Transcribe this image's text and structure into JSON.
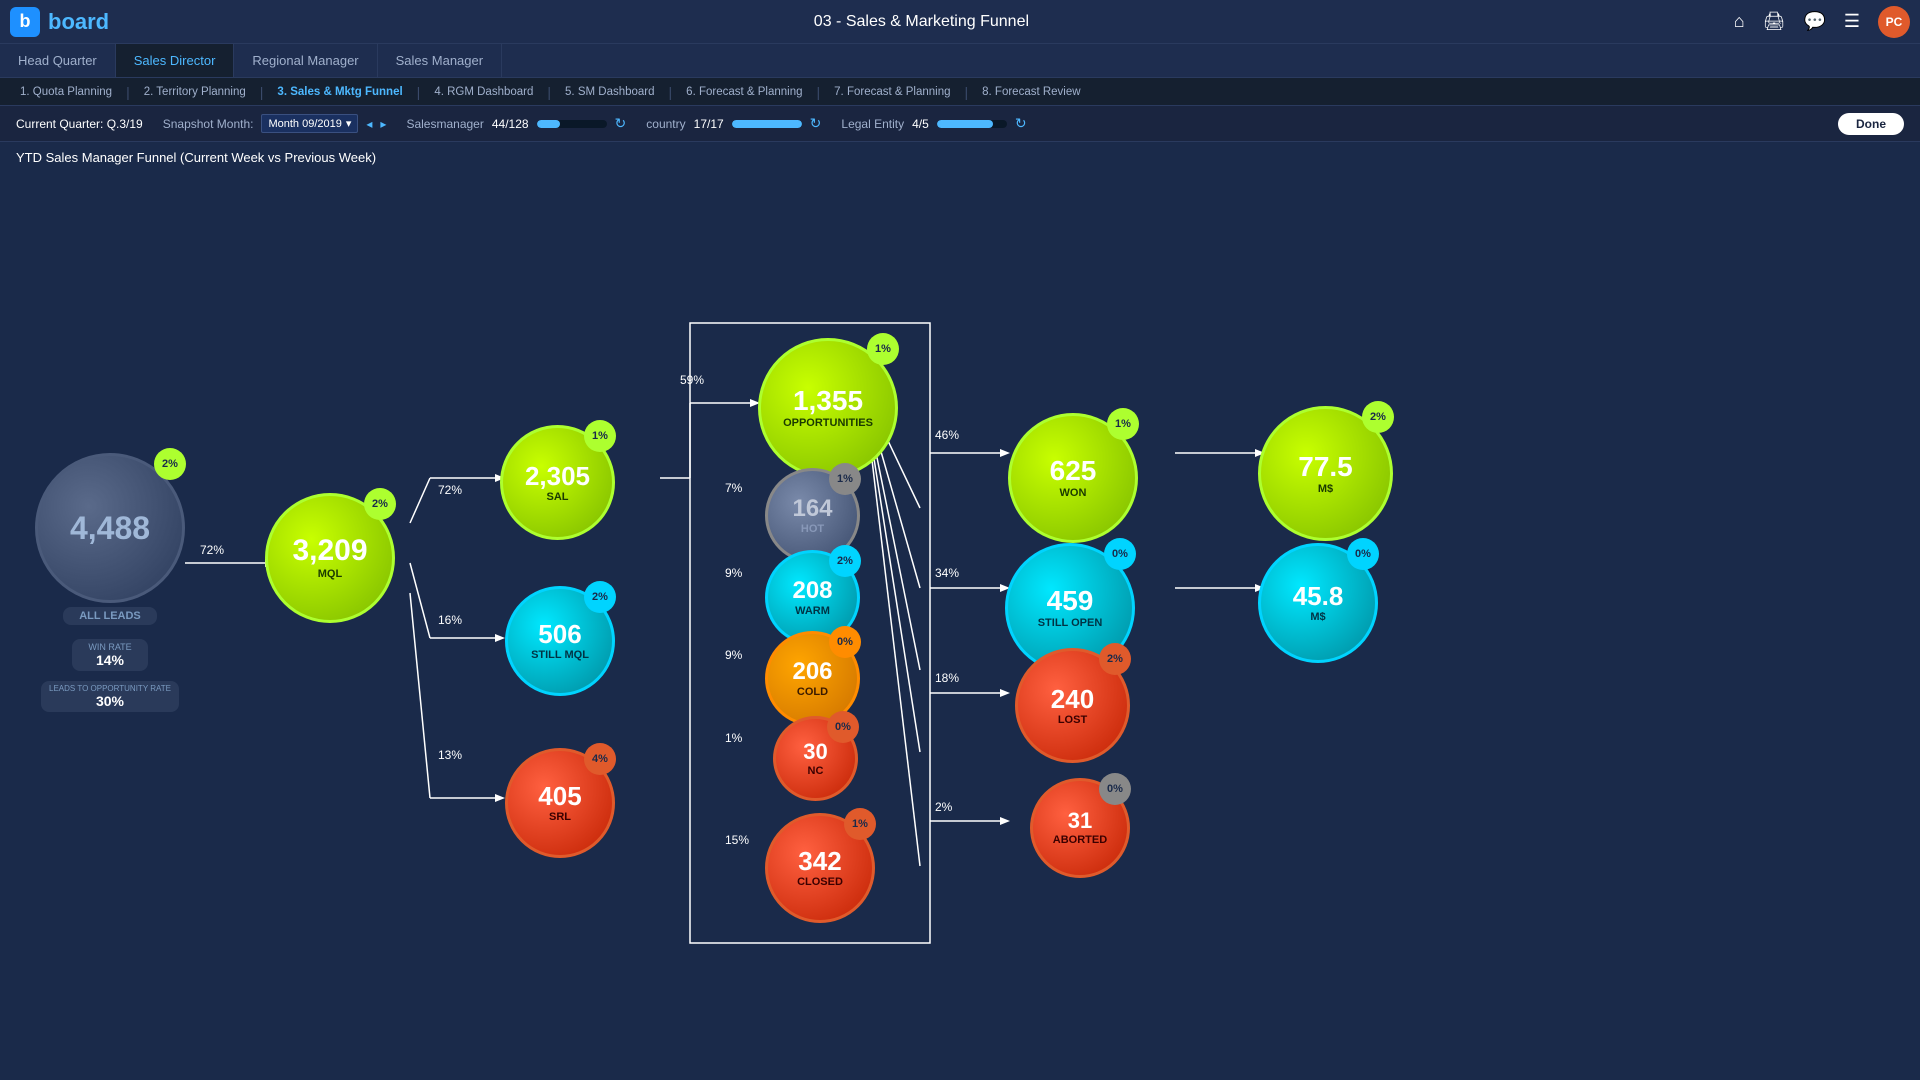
{
  "app": {
    "logo_letter": "b",
    "logo_name": "board",
    "page_title": "03 - Sales & Marketing Funnel",
    "avatar": "PC"
  },
  "nav_tabs": [
    {
      "id": "hq",
      "label": "Head Quarter",
      "active": false
    },
    {
      "id": "sd",
      "label": "Sales Director",
      "active": true
    },
    {
      "id": "rm",
      "label": "Regional Manager",
      "active": false
    },
    {
      "id": "sm",
      "label": "Sales Manager",
      "active": false
    }
  ],
  "sub_tabs": [
    {
      "id": "quota",
      "label": "1. Quota Planning",
      "active": false
    },
    {
      "id": "territory",
      "label": "2. Territory Planning",
      "active": false
    },
    {
      "id": "sales_mktg",
      "label": "3. Sales & Mktg Funnel",
      "active": true
    },
    {
      "id": "rgm_dash",
      "label": "4. RGM Dashboard",
      "active": false
    },
    {
      "id": "sm_dash",
      "label": "5. SM Dashboard",
      "active": false
    },
    {
      "id": "forecast6",
      "label": "6. Forecast & Planning",
      "active": false
    },
    {
      "id": "forecast7",
      "label": "7. Forecast & Planning",
      "active": false
    },
    {
      "id": "forecast8",
      "label": "8. Forecast Review",
      "active": false
    }
  ],
  "filters": {
    "current_quarter_label": "Current Quarter: Q.3/19",
    "snapshot_label": "Snapshot Month:",
    "snapshot_value": "Month 09/2019",
    "salesmanager_label": "Salesmanager",
    "salesmanager_value": "44/128",
    "salesmanager_pct": 34,
    "country_label": "country",
    "country_value": "17/17",
    "country_pct": 100,
    "legal_entity_label": "Legal Entity",
    "legal_entity_value": "4/5",
    "legal_entity_pct": 80,
    "done_label": "Done"
  },
  "chart_title": "YTD Sales Manager Funnel (Current Week vs Previous Week)",
  "nodes": {
    "all_leads": {
      "value": "4,488",
      "label": "ALL LEADS",
      "badge": "2%",
      "win_rate_label": "WIN RATE",
      "win_rate_value": "14%",
      "leads_rate_label": "LEADS TO OPPORTUNITY RATE",
      "leads_rate_value": "30%"
    },
    "mql": {
      "value": "3,209",
      "label": "MQL",
      "badge": "2%"
    },
    "sal": {
      "value": "2,305",
      "label": "SAL",
      "badge": "1%"
    },
    "still_mql": {
      "value": "506",
      "label": "Still MQL",
      "badge": "2%"
    },
    "srl": {
      "value": "405",
      "label": "SRL",
      "badge": "4%"
    },
    "opportunities": {
      "value": "1,355",
      "label": "Opportunities",
      "badge": "1%"
    },
    "hot": {
      "value": "164",
      "label": "HOT",
      "badge": "1%"
    },
    "warm": {
      "value": "208",
      "label": "Warm",
      "badge": "2%"
    },
    "cold": {
      "value": "206",
      "label": "Cold",
      "badge": "0%"
    },
    "nc": {
      "value": "30",
      "label": "NC",
      "badge": "0%"
    },
    "closed": {
      "value": "342",
      "label": "CLOSED",
      "badge": "1%"
    },
    "won": {
      "value": "625",
      "label": "WON",
      "badge": "1%"
    },
    "won_ms": {
      "value": "77.5",
      "label": "M$",
      "badge": "2%"
    },
    "still_open": {
      "value": "459",
      "label": "STILL OPEN",
      "badge": "0%"
    },
    "still_open_ms": {
      "value": "45.8",
      "label": "M$",
      "badge": "0%"
    },
    "lost": {
      "value": "240",
      "label": "LOST",
      "badge": "2%"
    },
    "aborted": {
      "value": "31",
      "label": "ABORTED",
      "badge": "0%"
    }
  },
  "flow_pcts": {
    "leads_to_mql": "72%",
    "mql_to_sal": "72%",
    "mql_to_still_mql": "16%",
    "mql_to_srl": "13%",
    "sal_to_opp": "59%",
    "opp_to_hot": "7%",
    "opp_to_warm": "9%",
    "opp_to_cold": "9%",
    "opp_to_nc": "1%",
    "opp_to_closed": "15%",
    "opp_to_won": "46%",
    "opp_to_still_open": "34%",
    "opp_to_lost": "18%",
    "opp_to_aborted": "2%"
  },
  "colors": {
    "bg": "#1a2a4a",
    "green": "#adff2f",
    "cyan": "#00d4ff",
    "orange": "#ff8c00",
    "red": "#e05a2b",
    "gray": "#4a5a7a",
    "accent_blue": "#4db8ff"
  }
}
